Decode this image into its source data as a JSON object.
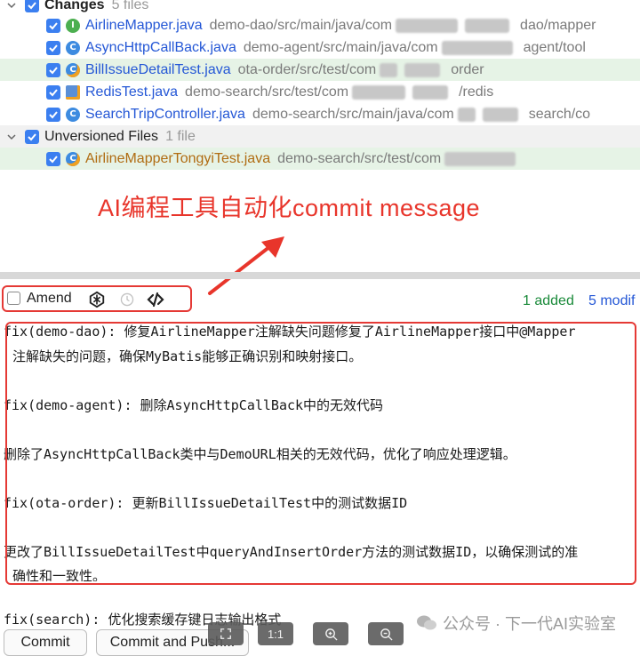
{
  "changes": {
    "label": "Changes",
    "count": "5 files",
    "files": [
      {
        "name": "AirlineMapper.java",
        "path_start": "demo-dao/src/main/java/com",
        "path_end": "dao/mapper",
        "icon": "interface-icon",
        "icon_letter": "I",
        "highlight": false
      },
      {
        "name": "AsyncHttpCallBack.java",
        "path_start": "demo-agent/src/main/java/com",
        "path_end": "agent/tool",
        "icon": "class-icon",
        "icon_letter": "C",
        "highlight": false
      },
      {
        "name": "BillIssueDetailTest.java",
        "path_start": "ota-order/src/test/com",
        "path_end": "order",
        "icon": "test-class-icon",
        "icon_letter": "C",
        "highlight": true
      },
      {
        "name": "RedisTest.java",
        "path_start": "demo-search/src/test/com",
        "path_end": "/redis",
        "icon": "test-file-icon",
        "icon_letter": "",
        "highlight": false
      },
      {
        "name": "SearchTripController.java",
        "path_start": "demo-search/src/main/java/com",
        "path_end": "search/co",
        "icon": "class-icon",
        "icon_letter": "C",
        "highlight": false
      }
    ]
  },
  "unversioned": {
    "label": "Unversioned Files",
    "count": "1 file",
    "files": [
      {
        "name": "AirlineMapperTongyiTest.java",
        "path_start": "demo-search/src/test/com",
        "path_end": "",
        "icon": "test-class-icon",
        "icon_letter": "C",
        "highlight": true
      }
    ]
  },
  "annotation": "AI编程工具自动化commit message",
  "toolbar": {
    "amend_label": "Amend",
    "added": "1 added",
    "modified": "5 modif"
  },
  "message": {
    "lines": [
      "fix(demo-dao): 修复AirlineMapper注解缺失问题修复了AirlineMapper接口中@Mapper",
      "注解缺失的问题，确保MyBatis能够正确识别和映射接口。",
      "",
      "fix(demo-agent): 删除AsyncHttpCallBack中的无效代码",
      "",
      "删除了AsyncHttpCallBack类中与DemoURL相关的无效代码，优化了响应处理逻辑。",
      "",
      "fix(ota-order): 更新BillIssueDetailTest中的测试数据ID",
      "",
      "更改了BillIssueDetailTest中queryAndInsertOrder方法的测试数据ID，以确保测试的准",
      "确性和一致性。"
    ],
    "tail": "fix(search): 优化搜索缓存键日志输出格式"
  },
  "buttons": {
    "commit": "Commit",
    "commit_push": "Commit and Push..."
  },
  "zoom": {
    "actual_size": "1:1"
  },
  "watermark": "公众号 · 下一代AI实验室",
  "colors": {
    "accent_blue": "#2457d6",
    "added_green": "#1a8a3a",
    "annotation_red": "#e8352b",
    "unversioned_orange": "#b06c12"
  }
}
